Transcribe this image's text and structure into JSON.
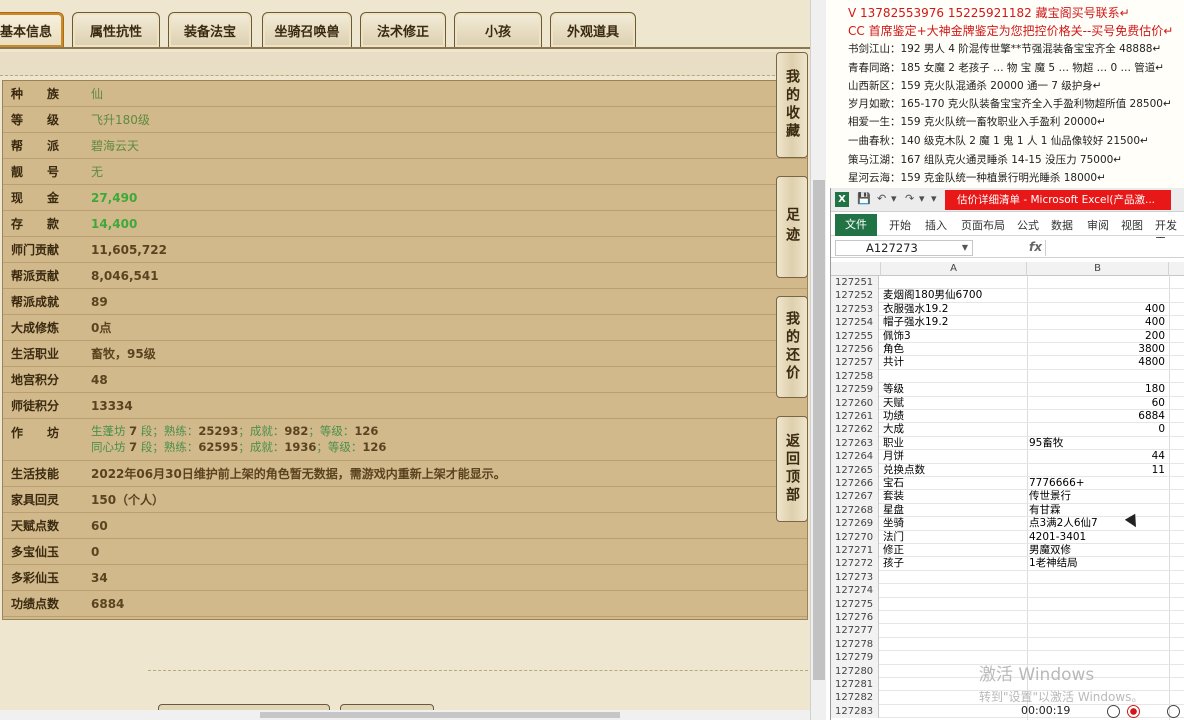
{
  "game": {
    "tabs": [
      {
        "label": "基本信息"
      },
      {
        "label": "属性抗性"
      },
      {
        "label": "装备法宝"
      },
      {
        "label": "坐骑召唤兽"
      },
      {
        "label": "法术修正"
      },
      {
        "label": "小孩"
      },
      {
        "label": "外观道具"
      }
    ],
    "side_buttons": [
      {
        "label": "我的收藏"
      },
      {
        "label": "足迹"
      },
      {
        "label": "我的还价"
      },
      {
        "label": "返回顶部"
      }
    ],
    "rows": [
      {
        "label": "种　　族",
        "value": "仙"
      },
      {
        "label": "等　　级",
        "value": "飞升180级"
      },
      {
        "label": "帮　　派",
        "value": "碧海云天"
      },
      {
        "label": "靓　　号",
        "value": "无"
      },
      {
        "label": "现　　金",
        "value": "27,490"
      },
      {
        "label": "存　　款",
        "value": "14,400"
      },
      {
        "label": "师门贡献",
        "value": "11,605,722"
      },
      {
        "label": "帮派贡献",
        "value": "8,046,541"
      },
      {
        "label": "帮派成就",
        "value": "89"
      },
      {
        "label": "大成修炼",
        "value": "0点"
      },
      {
        "label": "生活职业",
        "value": "畜牧，95级"
      },
      {
        "label": "地宫积分",
        "value": "48"
      },
      {
        "label": "师徒积分",
        "value": "13334"
      },
      {
        "label": "作　　坊",
        "lines": [
          {
            "name": "生蓬坊",
            "level": "7",
            "segs": "段；熟练：",
            "skill": "25293",
            "mid": "；成就：",
            "ach": "982",
            "end": "；等级：",
            "lv": "126"
          },
          {
            "name": "同心坊",
            "level": "7",
            "segs": "段；熟练：",
            "skill": "62595",
            "mid": "；成就：",
            "ach": "1936",
            "end": "；等级：",
            "lv": "126"
          }
        ]
      },
      {
        "label": "生活技能",
        "value": "2022年06月30日维护前上架的角色暂无数据，需游戏内重新上架才能显示。"
      },
      {
        "label": "家具回灵",
        "value": "150（个人）"
      },
      {
        "label": "天赋点数",
        "value": "60"
      },
      {
        "label": "多宝仙玉",
        "value": "0"
      },
      {
        "label": "多彩仙玉",
        "value": "34"
      },
      {
        "label": "功绩点数",
        "value": "6884"
      }
    ]
  },
  "notes": [
    {
      "text": "V 13782553976    15225921182   藏宝阁买号联系↵"
    },
    {
      "text": "CC 首席鉴定+大神金牌鉴定为您把控价格关--买号免费估价↵"
    },
    {
      "text": "书剑江山：192 男人 4 阶混传世擎**节强混装备宝宝齐全 48888↵"
    },
    {
      "text": "青春同路：185 女魔 2 老孩子 … 物 宝 魔 5 … 物超 … 0 … 管道↵"
    },
    {
      "text": "山西新区：159 克火队混通杀 20000 通一 7 级护身↵"
    },
    {
      "text": "岁月如歌：165-170 克火队装备宝宝齐全入手盈利物超所值 28500↵"
    },
    {
      "text": "相爱一生：159 克火队统一畜牧职业入手盈利 20000↵"
    },
    {
      "text": "一曲春秋：140 级克木队 2 魔 1 鬼 1 人 1 仙品像较好 21500↵"
    },
    {
      "text": "策马江湖：167 组队克火通灵睡杀 14-15 没压力 75000↵"
    },
    {
      "text": "星河云海：159 克金队统一种植景行明光睡杀 18000↵"
    }
  ],
  "excel": {
    "title": "估价详细清单 - Microsoft Excel(产品激...",
    "ribbon_tabs": [
      "文件",
      "开始",
      "插入",
      "页面布局",
      "公式",
      "数据",
      "审阅",
      "视图",
      "开发工"
    ],
    "name_box": "A127273",
    "fx": "fx",
    "col_headers": [
      "A",
      "B"
    ],
    "rows": [
      {
        "n": "127251",
        "a": "",
        "b": ""
      },
      {
        "n": "127252",
        "a": "麦烟阁180男仙6700",
        "b": ""
      },
      {
        "n": "127253",
        "a": "衣服强水19.2",
        "b": "400"
      },
      {
        "n": "127254",
        "a": "帽子强水19.2",
        "b": "400"
      },
      {
        "n": "127255",
        "a": "佩饰3",
        "b": "200"
      },
      {
        "n": "127256",
        "a": "角色",
        "b": "3800"
      },
      {
        "n": "127257",
        "a": "共计",
        "b": "4800"
      },
      {
        "n": "127258",
        "a": "",
        "b": ""
      },
      {
        "n": "127259",
        "a": "等级",
        "b": "180"
      },
      {
        "n": "127260",
        "a": "天赋",
        "b": "60"
      },
      {
        "n": "127261",
        "a": "功绩",
        "b": "6884"
      },
      {
        "n": "127262",
        "a": "大成",
        "b": "0"
      },
      {
        "n": "127263",
        "a": "职业",
        "b": "95畜牧",
        "btext": true
      },
      {
        "n": "127264",
        "a": "月饼",
        "b": "44"
      },
      {
        "n": "127265",
        "a": "兑换点数",
        "b": "11"
      },
      {
        "n": "127266",
        "a": "宝石",
        "b": "7776666+",
        "btext": true
      },
      {
        "n": "127267",
        "a": "套装",
        "b": "传世景行",
        "btext": true
      },
      {
        "n": "127268",
        "a": "星盘",
        "b": "有甘霖",
        "btext": true
      },
      {
        "n": "127269",
        "a": "坐骑",
        "b": "点3满2人6仙7",
        "btext": true
      },
      {
        "n": "127270",
        "a": "法门",
        "b": "4201-3401",
        "btext": true
      },
      {
        "n": "127271",
        "a": "修正",
        "b": "男魔双修",
        "btext": true
      },
      {
        "n": "127272",
        "a": "孩子",
        "b": "1老神结局",
        "btext": true
      },
      {
        "n": "127273",
        "a": "",
        "b": ""
      },
      {
        "n": "127274",
        "a": "",
        "b": ""
      },
      {
        "n": "127275",
        "a": "",
        "b": ""
      },
      {
        "n": "127276",
        "a": "",
        "b": ""
      },
      {
        "n": "127277",
        "a": "",
        "b": ""
      },
      {
        "n": "127278",
        "a": "",
        "b": ""
      },
      {
        "n": "127279",
        "a": "",
        "b": ""
      },
      {
        "n": "127280",
        "a": "",
        "b": ""
      },
      {
        "n": "127281",
        "a": "",
        "b": ""
      },
      {
        "n": "127282",
        "a": "",
        "b": ""
      },
      {
        "n": "127283",
        "a": "",
        "b": ""
      }
    ],
    "watermark": {
      "line1": "激活 Windows",
      "line2": "转到\"设置\"以激活 Windows。"
    },
    "recorder_time": "00:00:19"
  }
}
